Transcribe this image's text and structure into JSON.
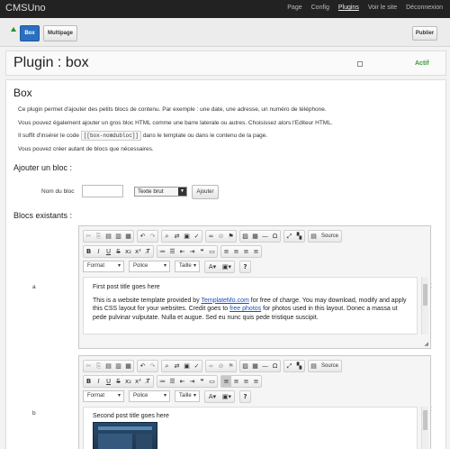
{
  "app": {
    "brand": "CMSUno"
  },
  "nav": [
    "Page",
    "Config",
    "Plugins",
    "Voir le site",
    "Déconnexion"
  ],
  "toolbar": {
    "box": "Box",
    "multipage": "Multipage",
    "publier": "Publier"
  },
  "header": {
    "title": "Plugin : box",
    "status": "Actif"
  },
  "box": {
    "heading": "Box",
    "desc1": "Ce plugin permet d'ajouter des petits blocs de contenu. Par exemple : une date, une adresse, un numéro de téléphone.",
    "desc2": "Vous pouvez également ajouter un gros bloc HTML comme une barre laterale ou autres. Choisissez alors l'Editeur HTML.",
    "desc3_pre": "Il suffit d'insérer le code",
    "desc3_code": "[[box-nomdubloc]]",
    "desc3_post": "dans le template ou dans le contenu de la page.",
    "desc4": "Vous pouvez créer autant de blocs que nécessaires."
  },
  "add": {
    "heading": "Ajouter un bloc :",
    "name_label": "Nom du bloc",
    "name_value": "",
    "type_selected": "Texte brut",
    "button": "Ajouter"
  },
  "existing": {
    "heading": "Blocs existants :",
    "blocks": [
      {
        "name": "a",
        "title": "First post title goes here",
        "p_pre": "This is a website template provided by",
        "link1": "TemplateMo.com",
        "p_mid": "for free of charge. You may download, modify",
        "p_line2_pre": "and apply this CSS layout for your websites. Credit goes to",
        "link2": "free photos",
        "p_line2_post": "for photos used in this layout.",
        "p_line3": "Donec a massa ut pede pulvinar vulputate. Nulla et augue. Sed eu nunc quis pede tristique suscipit."
      },
      {
        "name": "b",
        "title": "Second post title goes here"
      }
    ]
  },
  "editor": {
    "source": "Source",
    "format": "Format",
    "police": "Police",
    "taille": "Taille",
    "bold": "B",
    "italic": "I",
    "underline": "U",
    "strike": "S",
    "subscript": "x₂",
    "superscript": "x²",
    "close": "×"
  },
  "colors": {
    "accent": "#2a6fc0",
    "status": "#3a9a3a",
    "link": "#1a4fbf"
  }
}
